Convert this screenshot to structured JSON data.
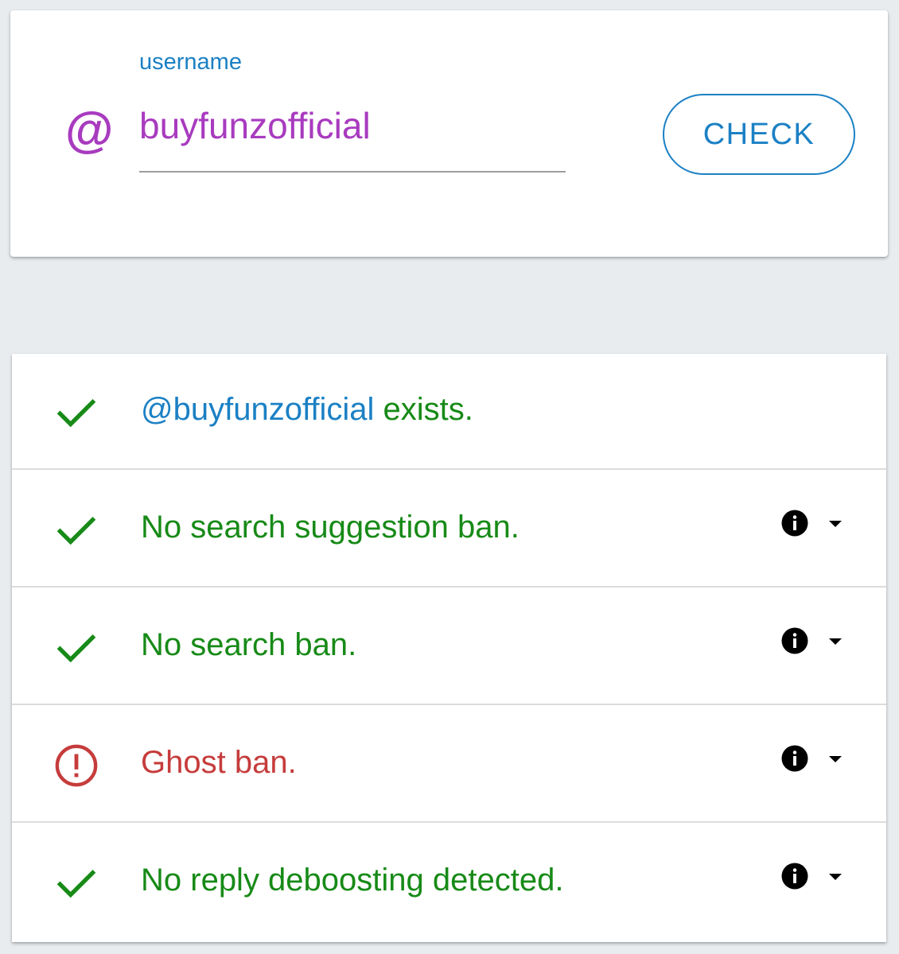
{
  "form": {
    "label": "username",
    "prefix_symbol": "@",
    "username_value": "buyfunzofficial",
    "check_button_label": "CHECK"
  },
  "results": [
    {
      "status": "ok",
      "icon": "check-icon",
      "handle": "@buyfunzofficial",
      "text": " exists.",
      "has_details": false
    },
    {
      "status": "ok",
      "icon": "check-icon",
      "text": "No search suggestion ban.",
      "has_details": true
    },
    {
      "status": "ok",
      "icon": "check-icon",
      "text": "No search ban.",
      "has_details": true
    },
    {
      "status": "warning",
      "icon": "alert-circle-icon",
      "text": "Ghost ban.",
      "has_details": true
    },
    {
      "status": "ok",
      "icon": "check-icon",
      "text": "No reply deboosting detected.",
      "has_details": true
    }
  ],
  "colors": {
    "accent_blue": "#1b80c4",
    "username_purple": "#a83bbf",
    "ok_green": "#178a17",
    "warning_red": "#c63c3c"
  }
}
